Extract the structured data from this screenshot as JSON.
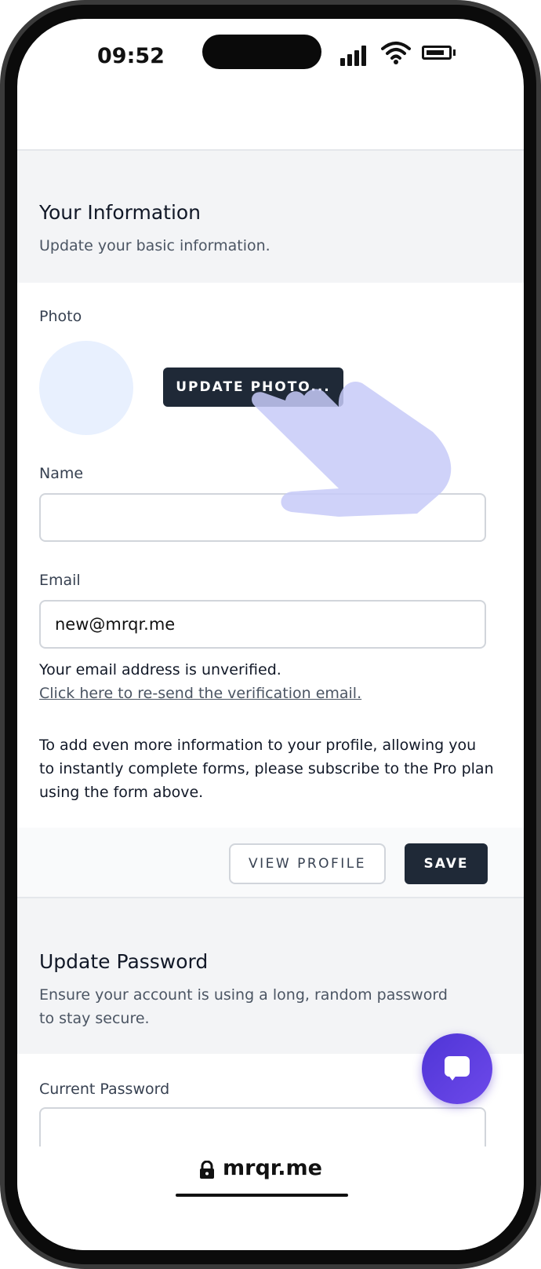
{
  "status_bar": {
    "time": "09:52"
  },
  "info_section": {
    "title": "Your Information",
    "description": "Update your basic information."
  },
  "photo": {
    "label": "Photo",
    "update_button": "UPDATE PHOTO..."
  },
  "name": {
    "label": "Name",
    "value": ""
  },
  "email": {
    "label": "Email",
    "value": "new@mrqr.me",
    "unverified_text": "Your email address is unverified.",
    "resend_link": "Click here to re-send the verification email."
  },
  "pro_notice": "To add even more information to your profile, allowing you to instantly complete forms, please subscribe to the Pro plan using the form above.",
  "actions": {
    "view_profile": "VIEW PROFILE",
    "save": "SAVE"
  },
  "password_section": {
    "title": "Update Password",
    "description": "Ensure your account is using a long, random password to stay secure.",
    "current_password_label": "Current Password"
  },
  "browser": {
    "url": "mrqr.me"
  },
  "colors": {
    "primary_button": "#1f2937",
    "section_bg": "#f3f4f6",
    "chat_accent": "#5b3fe0",
    "hand_overlay": "#c7caf8"
  },
  "icons": [
    "signal-icon",
    "wifi-icon",
    "battery-icon",
    "hand-pointer-icon",
    "chat-icon",
    "lock-icon"
  ]
}
